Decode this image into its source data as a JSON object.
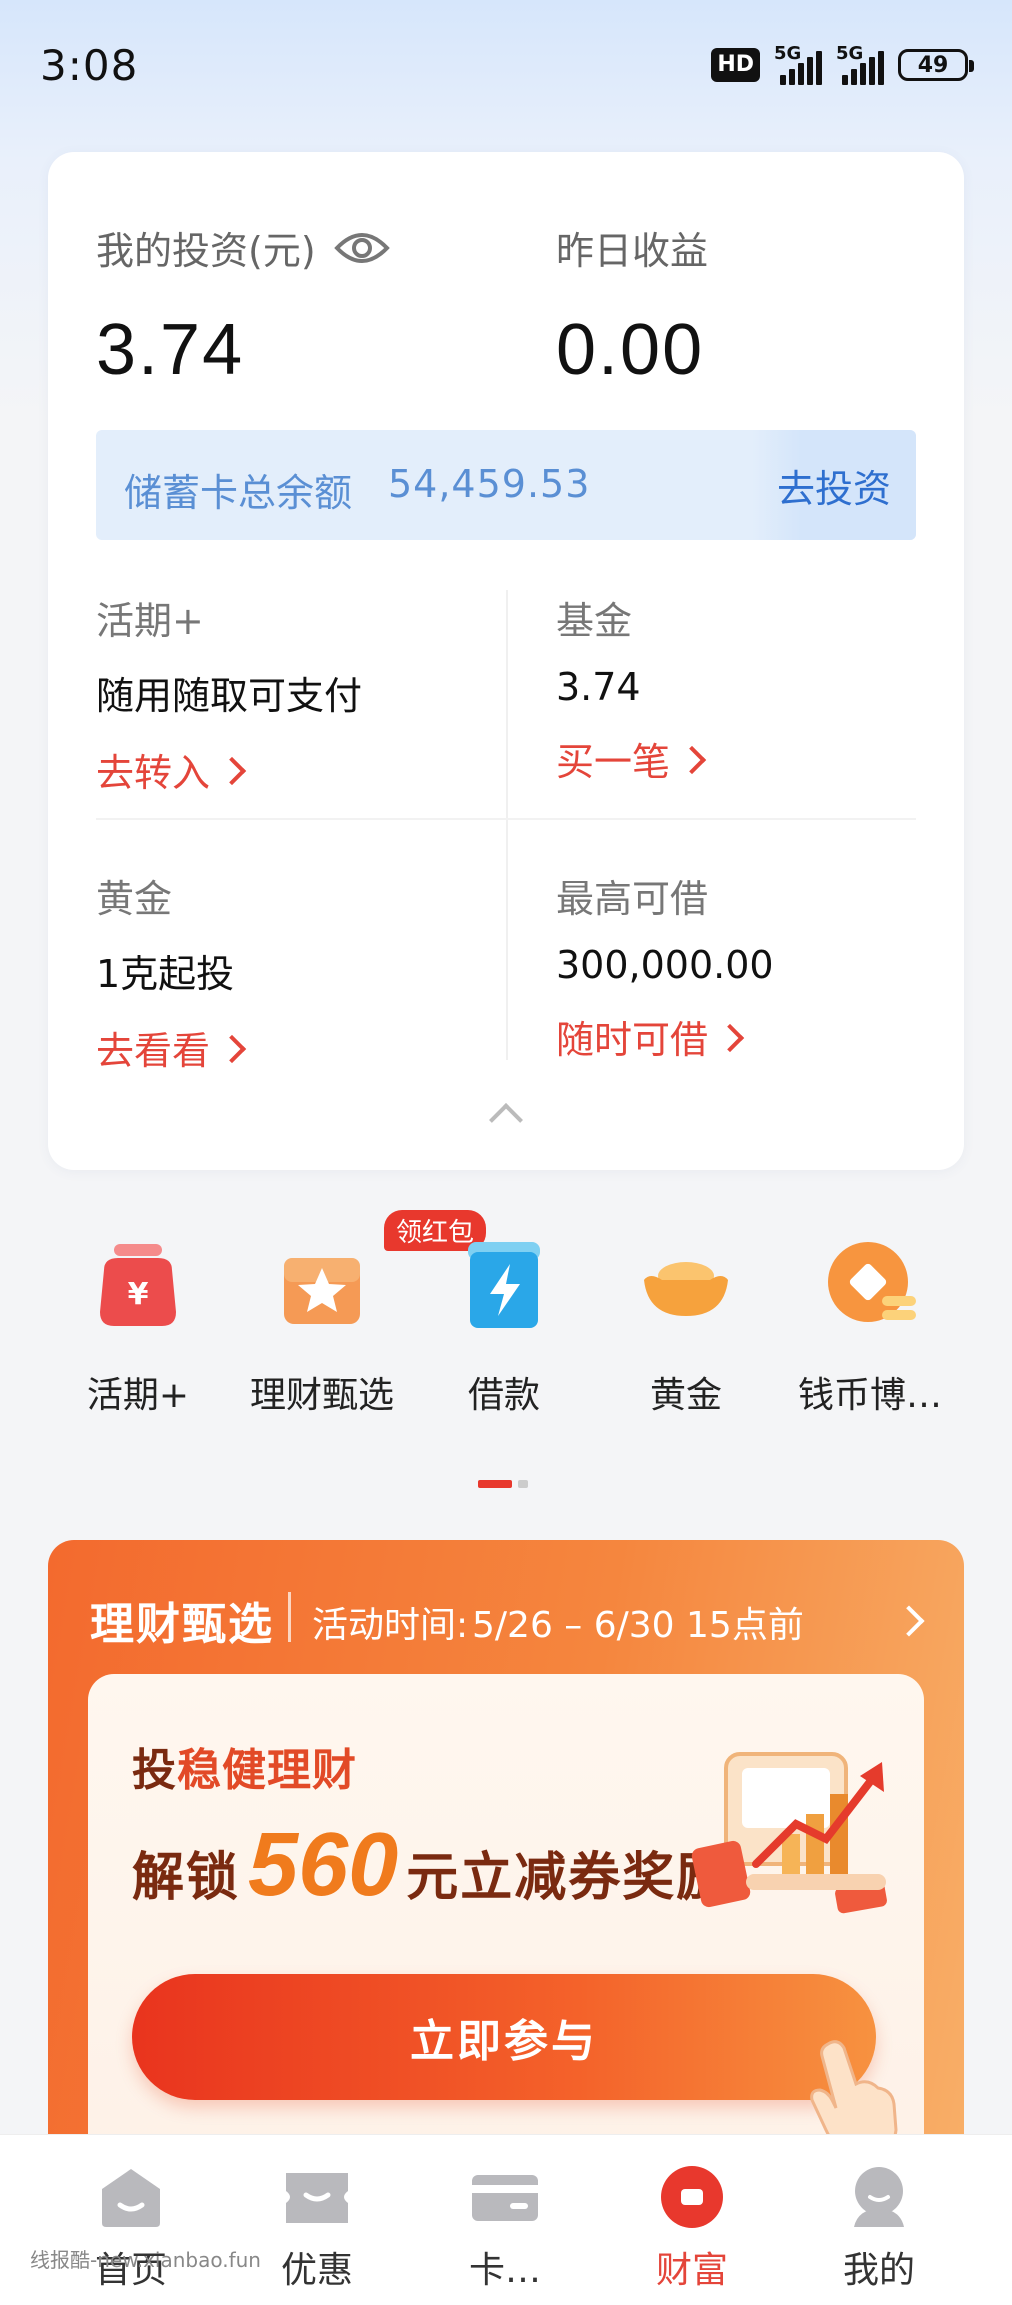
{
  "status": {
    "time": "3:08",
    "hd": "HD",
    "net1": "5G",
    "net2": "5G",
    "battery": "49"
  },
  "overview": {
    "investment_label": "我的投资(元)",
    "investment_value": "3.74",
    "yesterday_label": "昨日收益",
    "yesterday_value": "0.00",
    "balance_label": "储蓄卡总余额",
    "balance_value": "54,459.53",
    "invest_button": "去投资",
    "cells": [
      {
        "title": "活期+",
        "desc": "随用随取可支付",
        "link": "去转入"
      },
      {
        "title": "基金",
        "desc": "3.74",
        "link": "买一笔"
      },
      {
        "title": "黄金",
        "desc": "1克起投",
        "link": "去看看"
      },
      {
        "title": "最高可借",
        "desc": "300,000.00",
        "link": "随时可借"
      }
    ]
  },
  "quick_items": [
    {
      "label": "活期+",
      "icon": "money-bag-icon"
    },
    {
      "label": "理财甄选",
      "icon": "star-box-icon",
      "badge": "领红包"
    },
    {
      "label": "借款",
      "icon": "lightning-icon"
    },
    {
      "label": "黄金",
      "icon": "gold-ingot-icon"
    },
    {
      "label": "钱币博…",
      "icon": "coin-icon"
    }
  ],
  "promo": {
    "title": "理财甄选",
    "time_label": "活动时间:",
    "time_value": "5/26 – 6/30 15点前",
    "headline_prefix": "投",
    "headline_accent": "稳健理财",
    "unlock_text": "解锁",
    "amount": "560",
    "reward_text": "元立减券奖励",
    "button": "立即参与"
  },
  "nav": [
    {
      "label": "首页",
      "icon": "home-icon"
    },
    {
      "label": "优惠",
      "icon": "ticket-icon"
    },
    {
      "label": "卡…",
      "icon": "card-icon"
    },
    {
      "label": "财富",
      "icon": "wealth-icon",
      "active": true
    },
    {
      "label": "我的",
      "icon": "profile-icon"
    }
  ],
  "watermark": "线报酷-new.xianbao.fun",
  "colors": {
    "accent_red": "#e4453a",
    "link_blue": "#2e6fcf",
    "promo_orange": "#f36a2e"
  }
}
